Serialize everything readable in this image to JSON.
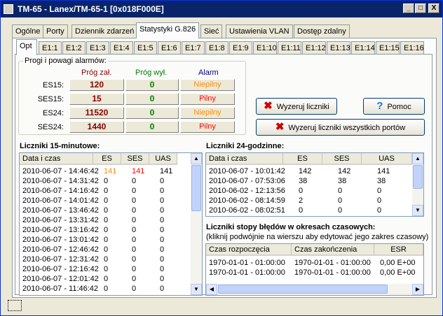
{
  "window": {
    "title": "TM-65 - Lanex/TM-65-1 [0x018F000E]",
    "min": "_",
    "max": "□",
    "close": "X"
  },
  "main_tabs": [
    "Ogólne",
    "Porty",
    "Dziennik zdarzeń",
    "Statystyki G.826",
    "Sieć",
    "Ustawienia VLAN",
    "Dostęp zdalny"
  ],
  "port_tabs": [
    "Opt",
    "E1:1",
    "E1:2",
    "E1:3",
    "E1:4",
    "E1:5",
    "E1:6",
    "E1:7",
    "E1:8",
    "E1:9",
    "E1:10",
    "E1:11",
    "E1:12",
    "E1:13",
    "E1:14",
    "E1:15",
    "E1:16"
  ],
  "thresholds": {
    "title": "Progi i powagi alarmów:",
    "col_on": "Próg zał.",
    "col_off": "Próg wył.",
    "col_alarm": "Alarm",
    "rows": [
      {
        "label": "ES15:",
        "on": "120",
        "off": "0",
        "alarm": "Niepilny",
        "alarm_color": "#ff8c00"
      },
      {
        "label": "SES15:",
        "on": "15",
        "off": "0",
        "alarm": "Pilny",
        "alarm_color": "#ff0000"
      },
      {
        "label": "ES24:",
        "on": "11520",
        "off": "0",
        "alarm": "Niepilny",
        "alarm_color": "#ff8c00"
      },
      {
        "label": "SES24:",
        "on": "1440",
        "off": "0",
        "alarm": "Pilny",
        "alarm_color": "#ff0000"
      }
    ]
  },
  "buttons": {
    "reset": "Wyzeruj liczniki",
    "help": "Pomoc",
    "reset_all": "Wyzeruj liczniki wszystkich portów"
  },
  "counters15": {
    "title": "Liczniki 15-minutowe:",
    "headers": [
      "Data i czas",
      "ES",
      "SES",
      "UAS"
    ],
    "rows": [
      [
        "2010-06-07 - 14:46:42",
        "141",
        "141",
        "141"
      ],
      [
        "2010-06-07 - 14:31:42",
        "0",
        "0",
        "0"
      ],
      [
        "2010-06-07 - 14:16:42",
        "0",
        "0",
        "0"
      ],
      [
        "2010-06-07 - 14:01:42",
        "0",
        "0",
        "0"
      ],
      [
        "2010-06-07 - 13:46:42",
        "0",
        "0",
        "0"
      ],
      [
        "2010-06-07 - 13:31:42",
        "0",
        "0",
        "0"
      ],
      [
        "2010-06-07 - 13:16:42",
        "0",
        "0",
        "0"
      ],
      [
        "2010-06-07 - 13:01:42",
        "0",
        "0",
        "0"
      ],
      [
        "2010-06-07 - 12:46:42",
        "0",
        "0",
        "0"
      ],
      [
        "2010-06-07 - 12:31:42",
        "0",
        "0",
        "0"
      ],
      [
        "2010-06-07 - 12:16:42",
        "0",
        "0",
        "0"
      ],
      [
        "2010-06-07 - 12:01:42",
        "0",
        "0",
        "0"
      ],
      [
        "2010-06-07 - 11:46:42",
        "0",
        "0",
        "0"
      ]
    ]
  },
  "counters24": {
    "title": "Liczniki 24-godzinne:",
    "headers": [
      "Data i czas",
      "ES",
      "SES",
      "UAS"
    ],
    "rows": [
      [
        "2010-06-07 - 10:01:42",
        "142",
        "142",
        "141"
      ],
      [
        "2010-06-07 - 07:53:06",
        "38",
        "38",
        "38"
      ],
      [
        "2010-06-02 - 12:13:56",
        "0",
        "0",
        "0"
      ],
      [
        "2010-06-02 - 08:14:59",
        "2",
        "0",
        "0"
      ],
      [
        "2010-06-02 - 08:02:51",
        "0",
        "0",
        "0"
      ]
    ]
  },
  "ber": {
    "title": "Liczniki stopy błędów w okresach czasowych:",
    "hint": "(kliknij podwójnie na wierszu aby edytować jego zakres czasowy)",
    "headers": [
      "Czas rozpoczęcia",
      "Czas zakończenia",
      "ESR"
    ],
    "rows": [
      [
        "1970-01-01 - 01:00:00",
        "1970-01-01 - 01:00:00",
        "0,00 E+00"
      ],
      [
        "1970-01-01 - 01:00:00",
        "1970-01-01 - 01:00:00",
        "0,00 E+00"
      ]
    ]
  }
}
